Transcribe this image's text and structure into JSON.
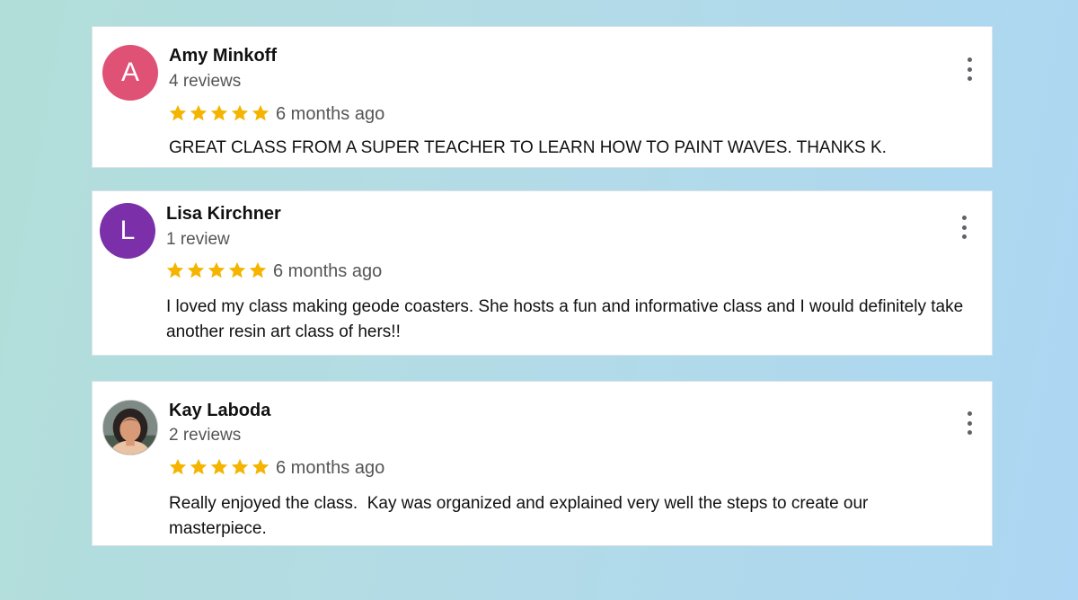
{
  "reviews": [
    {
      "name": "Amy Minkoff",
      "review_count": "4 reviews",
      "avatar_letter": "A",
      "avatar_color": "#e05176",
      "rating": 5,
      "date": "6 months ago",
      "text": "GREAT CLASS FROM A SUPER TEACHER TO LEARN HOW TO PAINT WAVES. THANKS K."
    },
    {
      "name": "Lisa Kirchner",
      "review_count": "1 review",
      "avatar_letter": "L",
      "avatar_color": "#7b2fa8",
      "rating": 5,
      "date": "6 months ago",
      "text": "I loved my class making geode coasters. She hosts a fun and informative class and I would definitely take another resin art class of hers!!"
    },
    {
      "name": "Kay Laboda",
      "review_count": "2 reviews",
      "avatar_letter": "",
      "avatar_color": "#6e5a4a",
      "rating": 5,
      "date": "6 months ago",
      "text": "Really enjoyed the class.  Kay was organized and explained very well the steps to create our masterpiece."
    }
  ],
  "star_color": "#f4b400",
  "menu_icon": "more-vert-icon"
}
